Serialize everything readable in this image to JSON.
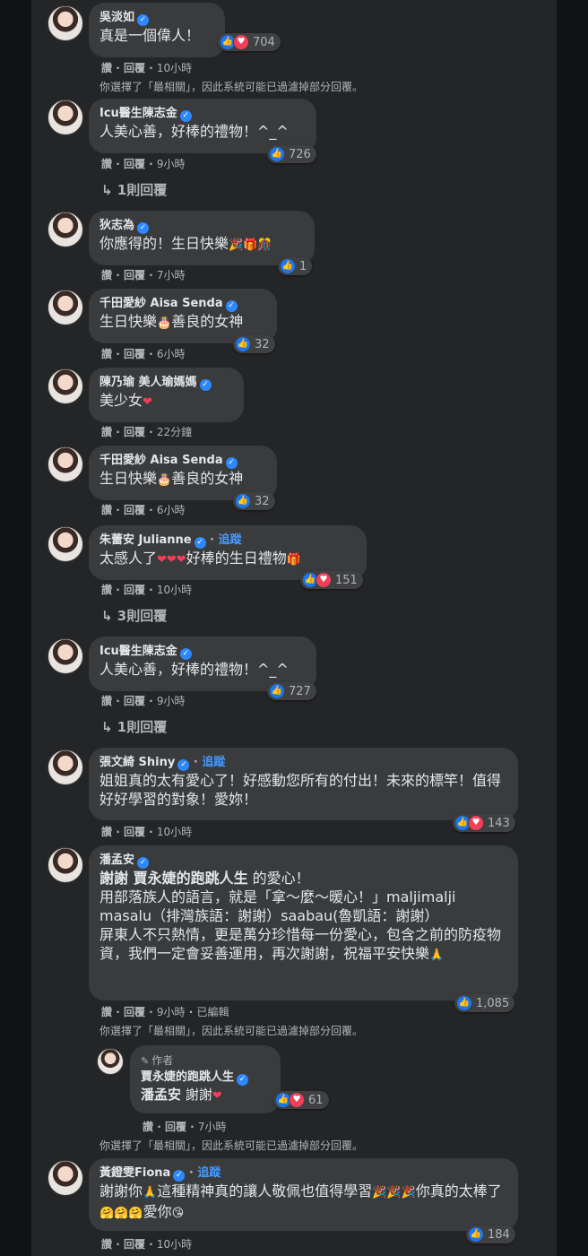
{
  "ui": {
    "like_action": "讚",
    "reply_action": "回覆",
    "sep": "·",
    "filter_notice": "你選擇了「最相關」，因此系統可能已過濾掉部分回覆。",
    "follow": "追蹤",
    "edited": "已編輯",
    "author_tag": "作者"
  },
  "comments": [
    {
      "name": "吳淡如",
      "text": "真是一個偉人！",
      "time": "10小時",
      "reactions": "704"
    },
    {
      "name": "Icu醫生陳志金",
      "text": "人美心善，好棒的禮物！^_^",
      "time": "9小時",
      "reactions": "726",
      "replies": "1則回覆"
    },
    {
      "name": "狄志為",
      "text": "你應得的！生日快樂",
      "time": "7小時",
      "reactions": "1"
    },
    {
      "name": "千田愛紗 Aisa Senda",
      "text": "生日快樂",
      "text2": "善良的女神",
      "time": "6小時",
      "reactions": "32"
    },
    {
      "name": "陳乃瑜 美人瑜媽媽",
      "text": "美少女",
      "time": "22分鐘"
    },
    {
      "name": "千田愛紗 Aisa Senda",
      "text": "生日快樂",
      "text2": "善良的女神",
      "time": "6小時",
      "reactions": "32"
    },
    {
      "name": "朱蕾安 Julianne",
      "text": "太感人了",
      "text2": "好棒的生日禮物",
      "time": "10小時",
      "reactions": "151",
      "replies": "3則回覆"
    },
    {
      "name": "Icu醫生陳志金",
      "text": "人美心善，好棒的禮物！^_^",
      "time": "9小時",
      "reactions": "727",
      "replies": "1則回覆"
    },
    {
      "name": "張文綺 Shiny",
      "text": "姐姐真的太有愛心了！好感動您所有的付出！未來的標竿！值得好好學習的對象！愛妳！",
      "time": "10小時",
      "reactions": "143"
    },
    {
      "name": "潘孟安",
      "mention": "謝謝 賈永婕的跑跳人生",
      "text": " 的愛心！\n用部落族人的語言，就是「拿～麼～暖心！」maljimalji masalu（排灣族語：謝謝）saabau(魯凱語：謝謝）\n屏東人不只熱情，更是萬分珍惜每一份愛心，包含之前的防疫物資，我們一定會妥善運用，再次謝謝，祝福平安快樂",
      "time": "9小時",
      "reactions": "1,085"
    },
    {
      "name": "賈永婕的跑跳人生",
      "mention": "潘孟安",
      "text": " 謝謝",
      "time": "7小時",
      "reactions": "61"
    },
    {
      "name": "黃鐙雯Fiona",
      "text": "謝謝你",
      "text2": "這種精神真的讓人敬佩也值得學習",
      "text3": "你真的太棒了",
      "text4": "愛你",
      "time": "10小時",
      "reactions": "184"
    }
  ]
}
